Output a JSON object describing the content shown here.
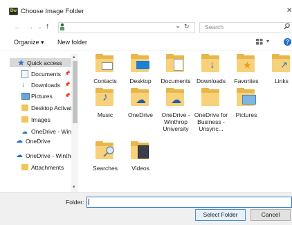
{
  "window": {
    "title": "Choose Image Folder"
  },
  "address": {
    "search_placeholder": "Search"
  },
  "toolbar": {
    "organize": "Organize ▾",
    "new_folder": "New folder"
  },
  "nav": {
    "items": [
      "Quick access",
      "Documents",
      "Downloads",
      "Pictures",
      "Desktop Activati",
      "Images",
      "OneDrive - Wint",
      "OneDrive",
      "OneDrive - Winthr",
      "Attachments"
    ]
  },
  "tiles": [
    {
      "label": "Contacts",
      "icon": "contacts-folder-icon"
    },
    {
      "label": "Desktop",
      "icon": "desktop-folder-icon"
    },
    {
      "label": "Documents",
      "icon": "documents-folder-icon"
    },
    {
      "label": "Downloads",
      "icon": "downloads-folder-icon"
    },
    {
      "label": "Favorites",
      "icon": "favorites-folder-icon"
    },
    {
      "label": "Links",
      "icon": "links-folder-icon"
    },
    {
      "label": "Music",
      "icon": "music-folder-icon"
    },
    {
      "label": "OneDrive",
      "icon": "onedrive-folder-icon"
    },
    {
      "label": "OneDrive - Winthrop University",
      "icon": "onedrive-folder-icon"
    },
    {
      "label": "OneDrive for Business - Unsync...",
      "icon": "folder-icon"
    },
    {
      "label": "Pictures",
      "icon": "pictures-folder-icon"
    },
    {
      "label": "Searches",
      "icon": "searches-folder-icon"
    },
    {
      "label": "Videos",
      "icon": "videos-folder-icon"
    }
  ],
  "bottom": {
    "folder_label": "Folder:",
    "folder_value": "",
    "select_button": "Select Folder",
    "cancel_button": "Cancel"
  }
}
